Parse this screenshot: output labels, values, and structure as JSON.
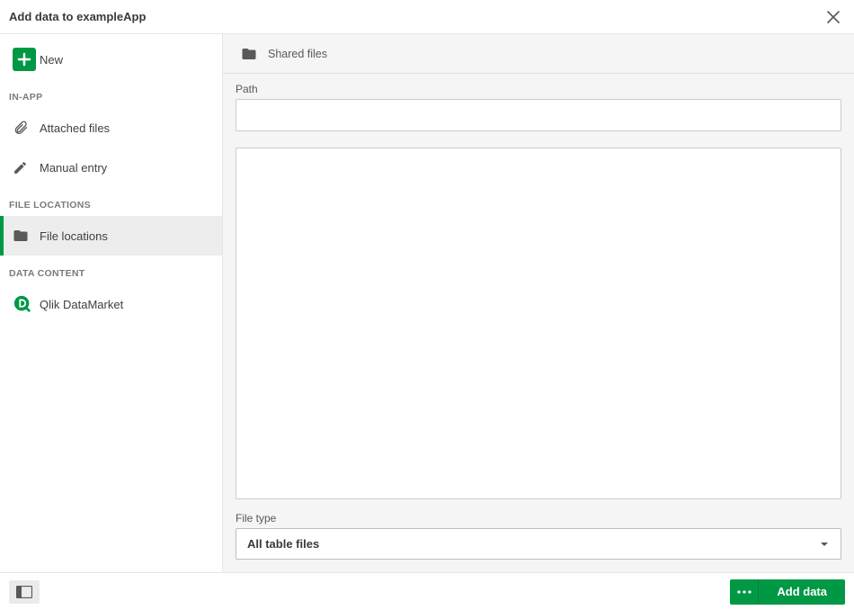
{
  "header": {
    "title": "Add data to exampleApp"
  },
  "sidebar": {
    "new_label": "New",
    "sections": {
      "in_app": {
        "label": "IN-APP",
        "items": [
          {
            "label": "Attached files",
            "icon": "paperclip-icon"
          },
          {
            "label": "Manual entry",
            "icon": "pencil-icon"
          }
        ]
      },
      "file_locations": {
        "label": "FILE LOCATIONS",
        "items": [
          {
            "label": "File locations",
            "icon": "folder-icon",
            "active": true
          }
        ]
      },
      "data_content": {
        "label": "DATA CONTENT",
        "items": [
          {
            "label": "Qlik DataMarket",
            "icon": "datamarket-icon"
          }
        ]
      }
    }
  },
  "main": {
    "breadcrumb_label": "Shared files",
    "path_label": "Path",
    "path_value": "",
    "file_type_label": "File type",
    "file_type_value": "All table files"
  },
  "footer": {
    "add_button_label": "Add data"
  }
}
